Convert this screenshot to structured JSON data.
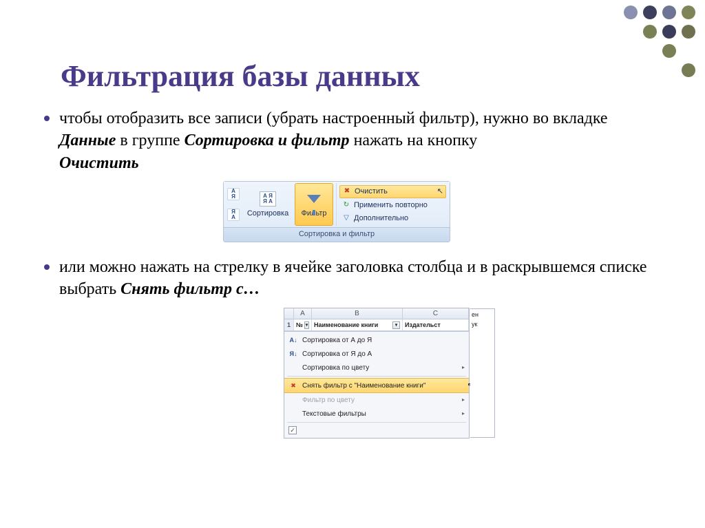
{
  "title": "Фильтрация базы данных",
  "bullet1": {
    "pre": "чтобы отобразить все записи (убрать настроенный фильтр), нужно во вкладке ",
    "b1": "Данные",
    "mid1": " в группе ",
    "b2": "Сортировка и фильтр",
    "mid2": " нажать на кнопку ",
    "b3": "Очистить"
  },
  "bullet2": {
    "pre": "или можно нажать на стрелку в ячейке заголовка столбца и в раскрывшемся списке выбрать ",
    "b1": "Снять фильтр с…"
  },
  "ribbon": {
    "sort_button": "Сортировка",
    "filter_button": "Фильтр",
    "clear": "Очистить",
    "reapply": "Применить повторно",
    "advanced": "Дополнительно",
    "caption": "Сортировка и фильтр"
  },
  "dropdown": {
    "cols": {
      "row": "",
      "a": "A",
      "b": "B",
      "c": "C"
    },
    "row1": "1",
    "hdr_a": "№",
    "hdr_b": "Наименование книги",
    "hdr_c": "Издательст",
    "items": {
      "sort_az": "Сортировка от А до Я",
      "sort_za": "Сортировка от Я до А",
      "sort_color": "Сортировка по цвету",
      "clear_filter": "Снять фильтр с \"Наименование книги\"",
      "filter_color": "Фильтр по цвету",
      "text_filters": "Текстовые фильтры"
    },
    "side": [
      "ен",
      "ук"
    ]
  }
}
